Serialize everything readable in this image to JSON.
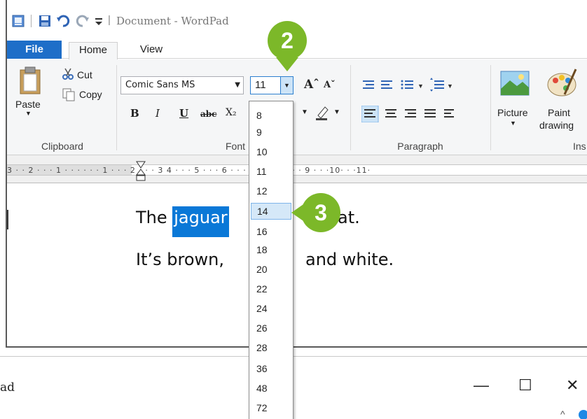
{
  "window": {
    "title": "Document - WordPad",
    "qat_separator": "|"
  },
  "tabs": [
    {
      "label": "File"
    },
    {
      "label": "Home"
    },
    {
      "label": "View"
    }
  ],
  "clipboard": {
    "paste_label": "Paste",
    "cut_label": "Cut",
    "copy_label": "Copy",
    "group_label": "Clipboard"
  },
  "font": {
    "family": "Comic Sans MS",
    "size": "11",
    "grow_label": "Aˆ",
    "shrink_label": "Aˇ",
    "bold": "B",
    "italic": "I",
    "underline": "U",
    "strike": "abc",
    "subscript": "X₂",
    "group_label": "Font"
  },
  "font_sizes": [
    "8",
    "9",
    "10",
    "11",
    "12",
    "14",
    "16",
    "18",
    "20",
    "22",
    "24",
    "26",
    "28",
    "36",
    "48",
    "72"
  ],
  "hovered_size": "14",
  "paragraph": {
    "group_label": "Paragraph"
  },
  "insert": {
    "picture_label": "Picture",
    "paint_label": "Paint",
    "paint_label2": "drawing",
    "group_label": "Ins"
  },
  "ruler": {
    "text": "3 · · 2 · · · 1 · · ·         · · · 1 · · · 2 · · · 3                        4 · · · 5 · · · 6 · · · 7 · · · 8 · · · 9 · · ·10· · ·11·"
  },
  "document": {
    "line1_before": "The ",
    "line1_selected": "jaguar",
    "line1_after": "at.",
    "line2_before": "It’s brown, ",
    "line2_after": "and white."
  },
  "callouts": {
    "step2": "2",
    "step3": "3"
  },
  "window2": {
    "title_fragment": "ad",
    "minimize": "—",
    "maximize": "☐",
    "close": "✕",
    "tray": "^"
  },
  "colors": {
    "file_tab": "#1e6ec8",
    "selection": "#0a78d7",
    "callout": "#7cb829"
  }
}
